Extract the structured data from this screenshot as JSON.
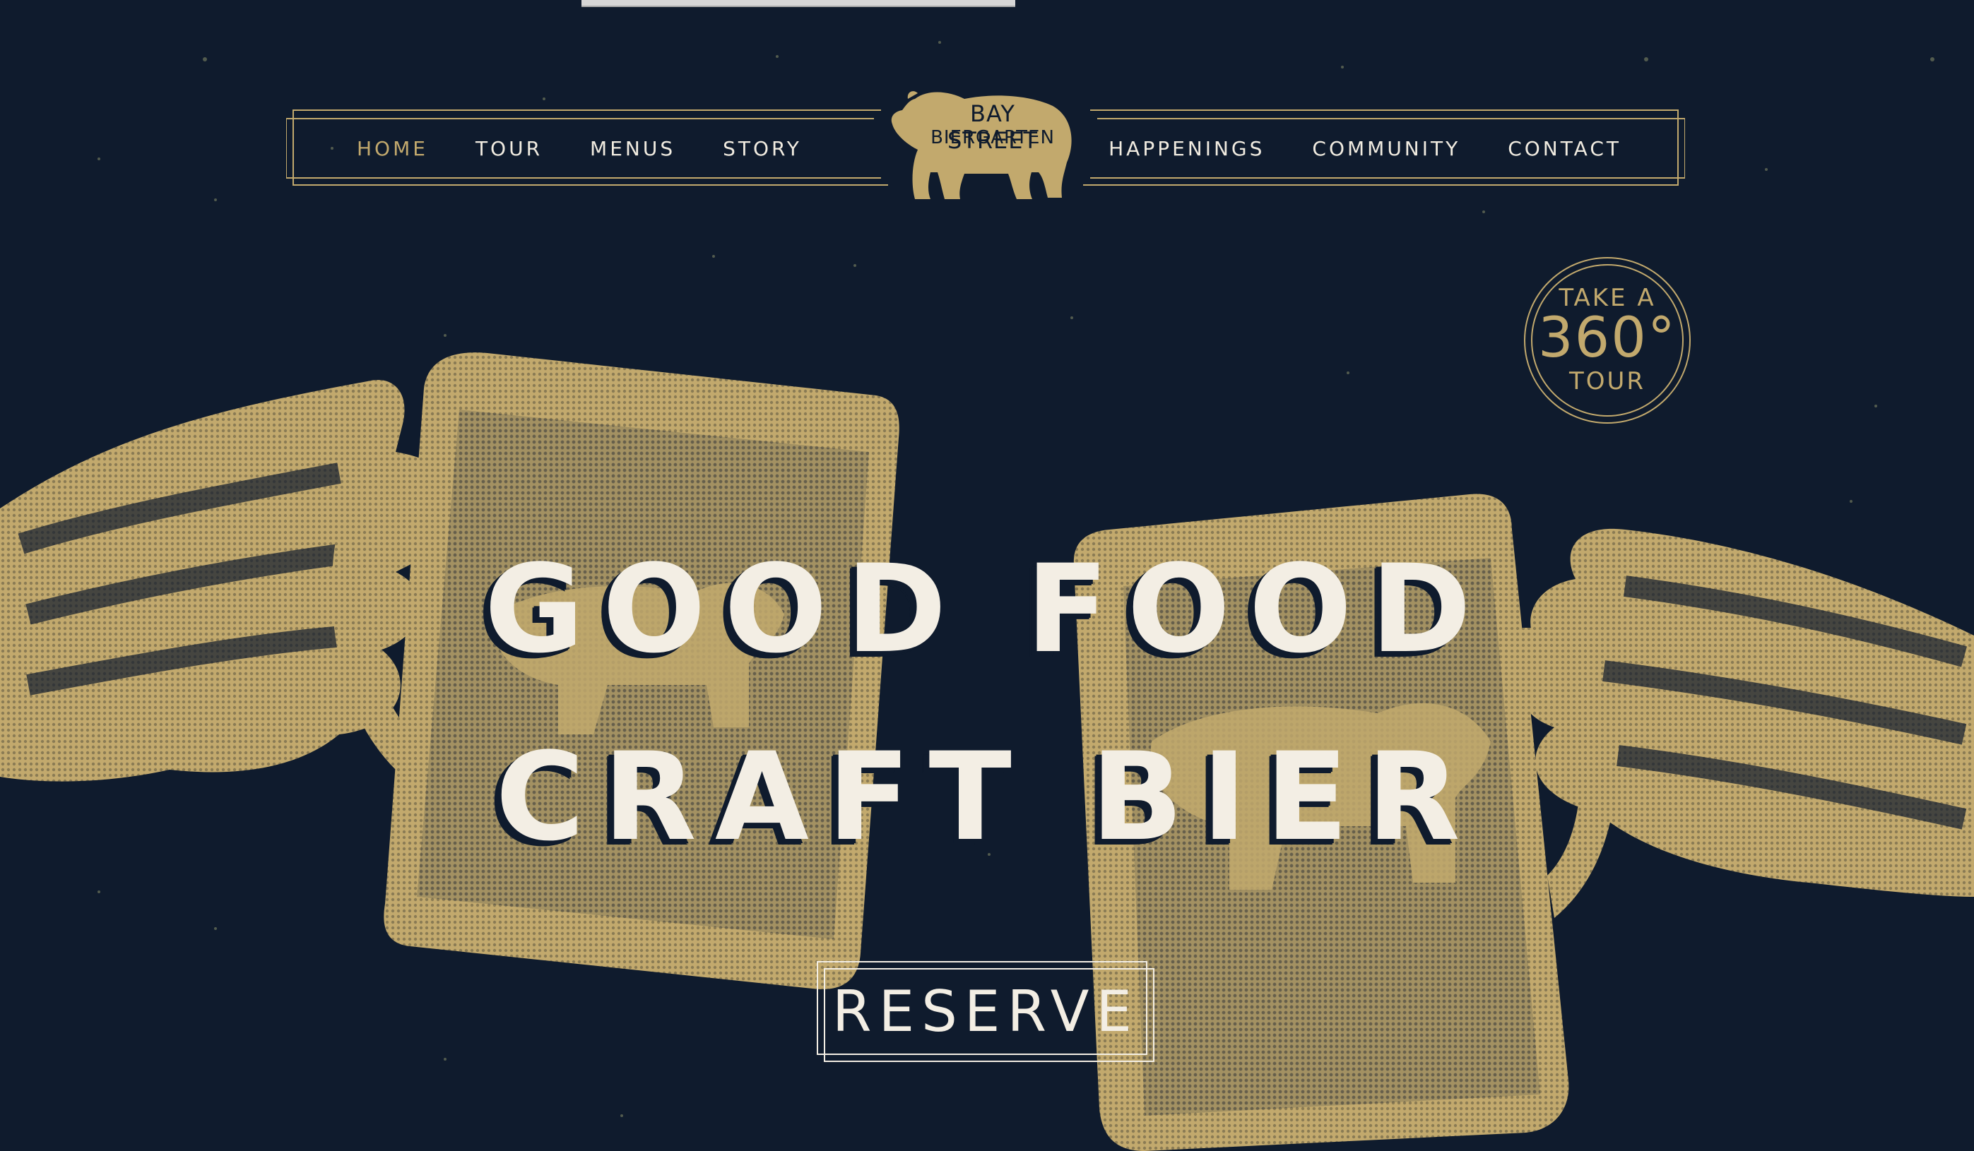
{
  "colors": {
    "background": "#0f1b2d",
    "gold": "#c2a96d",
    "cream": "#f3eee4"
  },
  "nav": {
    "left": [
      {
        "label": "HOME",
        "active": true
      },
      {
        "label": "TOUR",
        "active": false
      },
      {
        "label": "MENUS",
        "active": false
      },
      {
        "label": "STORY",
        "active": false
      }
    ],
    "right": [
      {
        "label": "HAPPENINGS"
      },
      {
        "label": "COMMUNITY"
      },
      {
        "label": "CONTACT"
      }
    ]
  },
  "logo": {
    "line1": "BAY STREET",
    "line2": "BIERGARTEN",
    "icon": "bear-icon"
  },
  "badge": {
    "top": "TAKE A",
    "number": "360°",
    "bottom": "TOUR"
  },
  "hero": {
    "line1": "GOOD FOOD",
    "line2": "CRAFT BIER",
    "illustration": "beer-mugs-toast-illustration"
  },
  "cta": {
    "label": "RESERVE"
  }
}
